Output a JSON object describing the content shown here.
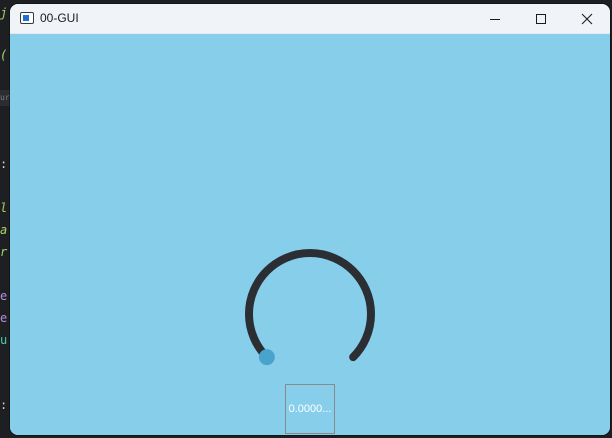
{
  "window": {
    "title": "00-GUI",
    "client_bg": "#87ceeb"
  },
  "background_editor": {
    "glyphs": [
      "j",
      "(",
      "ur",
      ":",
      "l",
      "a",
      "r",
      "e",
      "e",
      "u",
      ":"
    ]
  },
  "dial": {
    "value_text": "0.0000...",
    "value_fraction": 0.0,
    "track_color": "#2b2f33",
    "handle_color": "#4aa3cc"
  },
  "icons": {
    "app": "app-icon",
    "minimize": "minimize-icon",
    "maximize": "maximize-icon",
    "close": "close-icon"
  }
}
